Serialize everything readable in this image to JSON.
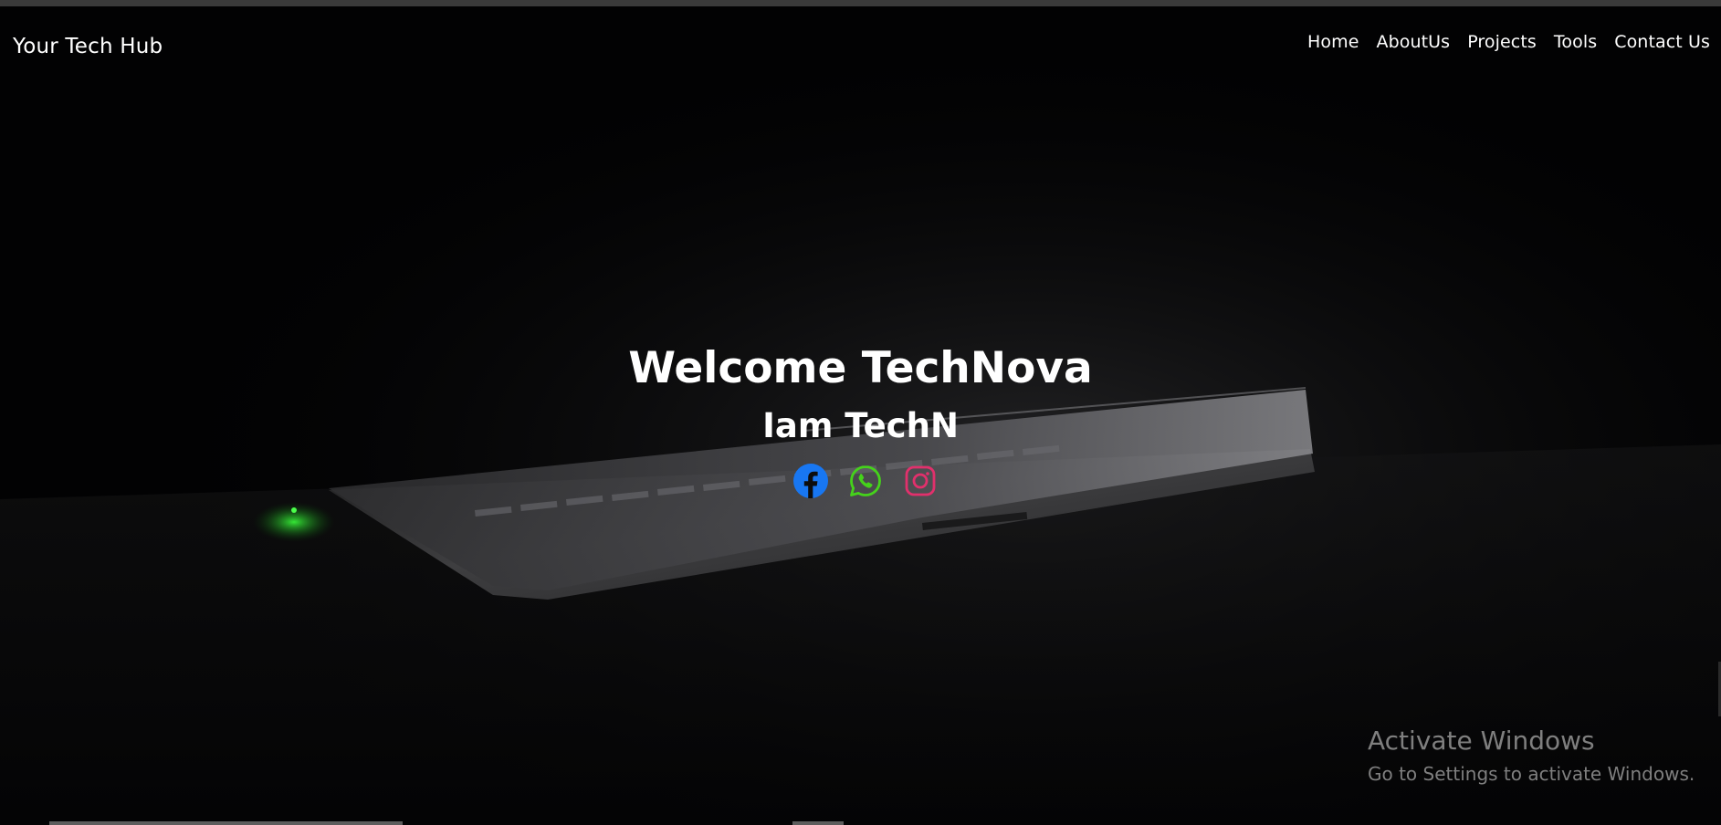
{
  "header": {
    "brand": "Your Tech Hub",
    "nav": [
      "Home",
      "AboutUs",
      "Projects",
      "Tools",
      "Contact Us"
    ]
  },
  "hero": {
    "title": "Welcome TechNova",
    "subtitle": "Iam TechN",
    "socials": [
      {
        "icon": "facebook-icon",
        "color": "#1877f2"
      },
      {
        "icon": "whatsapp-icon",
        "color": "#45d21b"
      },
      {
        "icon": "instagram-icon",
        "color": "#e1306c"
      }
    ]
  },
  "watermark": {
    "title": "Activate Windows",
    "text": "Go to Settings to activate Windows."
  }
}
